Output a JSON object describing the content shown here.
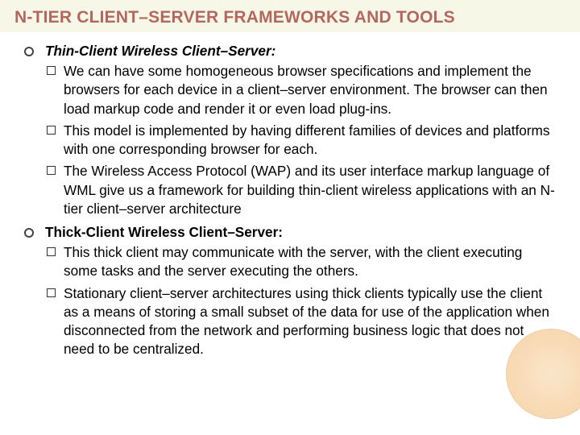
{
  "title": "N-TIER CLIENT–SERVER FRAMEWORKS AND TOOLS",
  "sections": [
    {
      "heading": "Thin-Client Wireless Client–Server:",
      "items": [
        "We can have some homogeneous browser specifications and implement the browsers for each device in a client–server environment. The browser can then load markup code and render it or even load plug-ins.",
        "This model is implemented by having different families of devices and platforms with one corresponding browser for each.",
        "The Wireless Access Protocol (WAP) and its user interface markup language of WML give us a framework for building thin-client wireless applications with an N-tier client–server architecture"
      ]
    },
    {
      "heading": "Thick-Client Wireless Client–Server:",
      "items": [
        "This thick client may communicate with the server, with the client executing some tasks and the server executing the others.",
        "Stationary client–server architectures using thick clients typically use the client as a means of storing a small subset of the data for use of the application when disconnected from the network and performing business logic that does not need to be centralized."
      ]
    }
  ]
}
